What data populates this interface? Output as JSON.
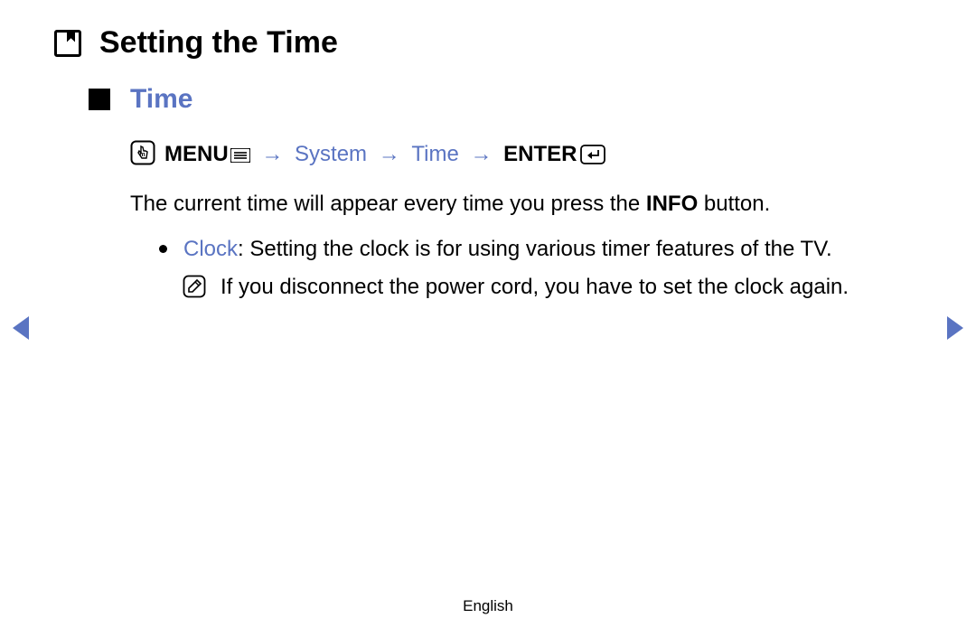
{
  "page": {
    "title": "Setting the Time",
    "language": "English"
  },
  "section": {
    "title": "Time",
    "nav_path": {
      "menu_label": "MENU",
      "step1": "System",
      "step2": "Time",
      "enter_label": "ENTER",
      "arrow": "→"
    },
    "description_pre": "The current time will appear every time you press the ",
    "description_bold": "INFO",
    "description_post": " button.",
    "bullet": {
      "label": "Clock",
      "text": ": Setting the clock is for using various timer features of the TV."
    },
    "note": {
      "text": "If you disconnect the power cord, you have to set the clock again."
    }
  }
}
